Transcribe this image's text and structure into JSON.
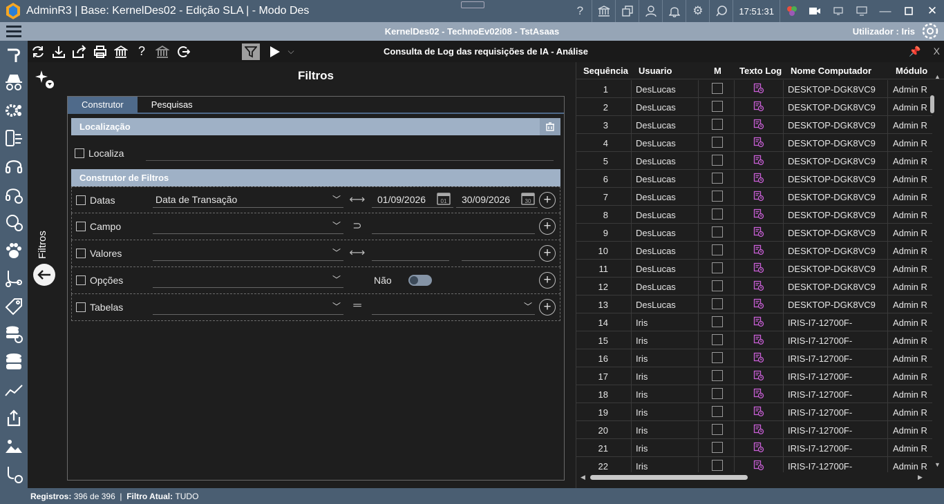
{
  "titlebar": {
    "title": "AdminR3 | Base: KernelDes02 - Edição SLA | - Modo Des",
    "clock": "17:51:31"
  },
  "subbar": {
    "center": "KernelDes02 - TechnoEv02i08 - TstAsaas",
    "user": "Utilizador : Iris"
  },
  "toolbar": {
    "title": "Consulta de Log das requisições de IA - Análise",
    "close": "X"
  },
  "filters": {
    "side_label": "Filtros",
    "title": "Filtros",
    "tabs": [
      "Construtor",
      "Pesquisas"
    ],
    "section_localizacao": "Localização",
    "localiza_label": "Localiza",
    "section_construtor": "Construtor de Filtros",
    "rows": {
      "datas": {
        "label": "Datas",
        "combo": "Data de Transação",
        "date_from": "01/09/2026",
        "date_to": "30/09/2026",
        "cal_from": "01",
        "cal_to": "30"
      },
      "campo": {
        "label": "Campo"
      },
      "valores": {
        "label": "Valores"
      },
      "opcoes": {
        "label": "Opções",
        "toggle_label": "Não"
      },
      "tabelas": {
        "label": "Tabelas"
      }
    }
  },
  "grid": {
    "columns": [
      "Sequência",
      "Usuario",
      "M",
      "Texto Log",
      "Nome Computador",
      "Módulo"
    ],
    "rows": [
      {
        "seq": "1",
        "user": "DesLucas",
        "computer": "DESKTOP-DGK8VC9",
        "module": "Admin R"
      },
      {
        "seq": "2",
        "user": "DesLucas",
        "computer": "DESKTOP-DGK8VC9",
        "module": "Admin R"
      },
      {
        "seq": "3",
        "user": "DesLucas",
        "computer": "DESKTOP-DGK8VC9",
        "module": "Admin R"
      },
      {
        "seq": "4",
        "user": "DesLucas",
        "computer": "DESKTOP-DGK8VC9",
        "module": "Admin R"
      },
      {
        "seq": "5",
        "user": "DesLucas",
        "computer": "DESKTOP-DGK8VC9",
        "module": "Admin R"
      },
      {
        "seq": "6",
        "user": "DesLucas",
        "computer": "DESKTOP-DGK8VC9",
        "module": "Admin R"
      },
      {
        "seq": "7",
        "user": "DesLucas",
        "computer": "DESKTOP-DGK8VC9",
        "module": "Admin R"
      },
      {
        "seq": "8",
        "user": "DesLucas",
        "computer": "DESKTOP-DGK8VC9",
        "module": "Admin R"
      },
      {
        "seq": "9",
        "user": "DesLucas",
        "computer": "DESKTOP-DGK8VC9",
        "module": "Admin R"
      },
      {
        "seq": "10",
        "user": "DesLucas",
        "computer": "DESKTOP-DGK8VC9",
        "module": "Admin R"
      },
      {
        "seq": "11",
        "user": "DesLucas",
        "computer": "DESKTOP-DGK8VC9",
        "module": "Admin R"
      },
      {
        "seq": "12",
        "user": "DesLucas",
        "computer": "DESKTOP-DGK8VC9",
        "module": "Admin R"
      },
      {
        "seq": "13",
        "user": "DesLucas",
        "computer": "DESKTOP-DGK8VC9",
        "module": "Admin R"
      },
      {
        "seq": "14",
        "user": "Iris",
        "computer": "IRIS-I7-12700F-",
        "module": "Admin R"
      },
      {
        "seq": "15",
        "user": "Iris",
        "computer": "IRIS-I7-12700F-",
        "module": "Admin R"
      },
      {
        "seq": "16",
        "user": "Iris",
        "computer": "IRIS-I7-12700F-",
        "module": "Admin R"
      },
      {
        "seq": "17",
        "user": "Iris",
        "computer": "IRIS-I7-12700F-",
        "module": "Admin R"
      },
      {
        "seq": "18",
        "user": "Iris",
        "computer": "IRIS-I7-12700F-",
        "module": "Admin R"
      },
      {
        "seq": "19",
        "user": "Iris",
        "computer": "IRIS-I7-12700F-",
        "module": "Admin R"
      },
      {
        "seq": "20",
        "user": "Iris",
        "computer": "IRIS-I7-12700F-",
        "module": "Admin R"
      },
      {
        "seq": "21",
        "user": "Iris",
        "computer": "IRIS-I7-12700F-",
        "module": "Admin R"
      },
      {
        "seq": "22",
        "user": "Iris",
        "computer": "IRIS-I7-12700F-",
        "module": "Admin R"
      }
    ]
  },
  "status": {
    "registros_label": "Registros:",
    "registros_value": "396 de 396",
    "filtro_label": "Filtro Atual:",
    "filtro_value": "TUDO"
  },
  "colors": {
    "titlebar": "#4a5e72",
    "subbar": "#96a5b6",
    "section_header": "#9fb1c6",
    "active_tab": "#4f6a8a",
    "log_icon": "#c95fd6"
  }
}
